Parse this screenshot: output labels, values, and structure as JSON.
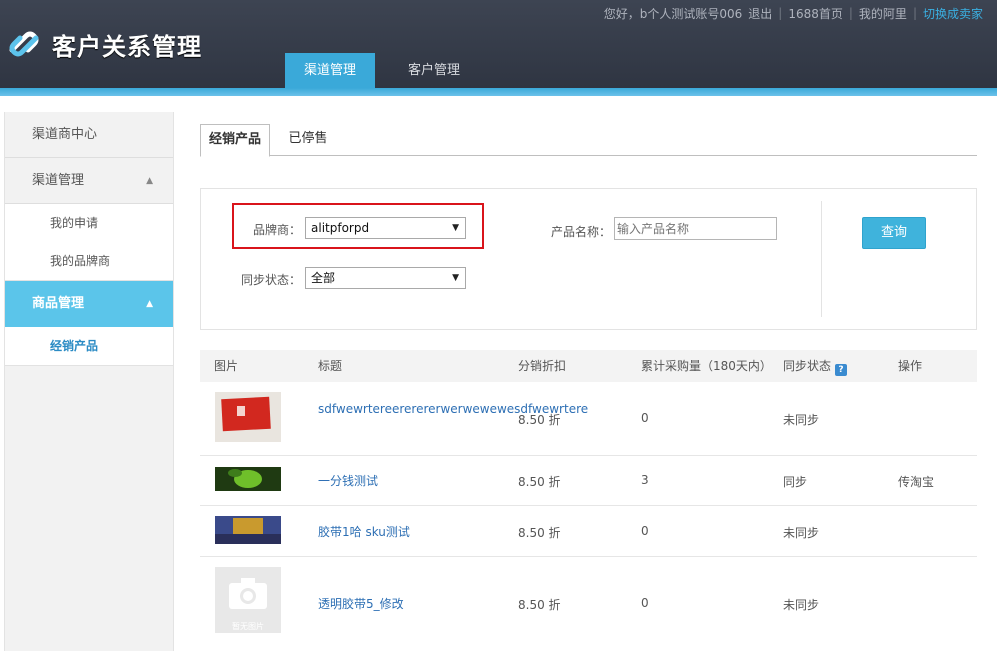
{
  "header": {
    "logo_text": "客户关系管理",
    "top_links": {
      "greeting": "您好，b个人测试账号006",
      "logout": "退出",
      "home": "1688首页",
      "my_ali": "我的阿里",
      "switch_seller": "切换成卖家"
    },
    "nav_tabs": [
      {
        "label": "渠道管理",
        "active": true
      },
      {
        "label": "客户管理",
        "active": false
      }
    ],
    "colors": {
      "header_bg": "#2f3542",
      "accent": "#3aa9d9"
    }
  },
  "sidebar": {
    "channel_center": "渠道商中心",
    "channel_mgmt": {
      "label": "渠道管理",
      "arrow": "▲"
    },
    "channel_sub": [
      "我的申请",
      "我的品牌商"
    ],
    "goods_mgmt": {
      "label": "商品管理",
      "arrow": "▲"
    },
    "goods_sub": [
      "经销产品"
    ]
  },
  "main": {
    "tabs": [
      {
        "label": "经销产品",
        "active": true
      },
      {
        "label": "已停售",
        "active": false
      }
    ],
    "filter": {
      "brand_label": "品牌商：",
      "brand_value": "alitpforpd",
      "sync_label": "同步状态：",
      "sync_value": "全部",
      "product_label": "产品名称：",
      "product_placeholder": "输入产品名称",
      "query_button": "查询",
      "caret": "▼"
    },
    "table": {
      "headers": {
        "image": "图片",
        "title": "标题",
        "discount": "分销折扣",
        "purchases": "累计采购量（180天内）",
        "sync": "同步状态",
        "action": "操作"
      },
      "help_icon": "?",
      "rows": [
        {
          "title": "sdfwewrtereererererwerwewewesdfwewrtere",
          "discount": "8.50 折",
          "purchases": "0",
          "sync": "未同步",
          "action": "",
          "thumb": "red-card"
        },
        {
          "title": "一分钱测试",
          "discount": "8.50 折",
          "purchases": "3",
          "sync": "同步",
          "action": "传淘宝",
          "thumb": "green-leaf"
        },
        {
          "title": "胶带1哈 sku测试",
          "discount": "8.50 折",
          "purchases": "0",
          "sync": "未同步",
          "action": "",
          "thumb": "game-banner"
        },
        {
          "title": "透明胶带5_修改",
          "discount": "8.50 折",
          "purchases": "0",
          "sync": "未同步",
          "action": "",
          "thumb": "no-image"
        }
      ],
      "no_image_text": "暂无图片"
    }
  }
}
